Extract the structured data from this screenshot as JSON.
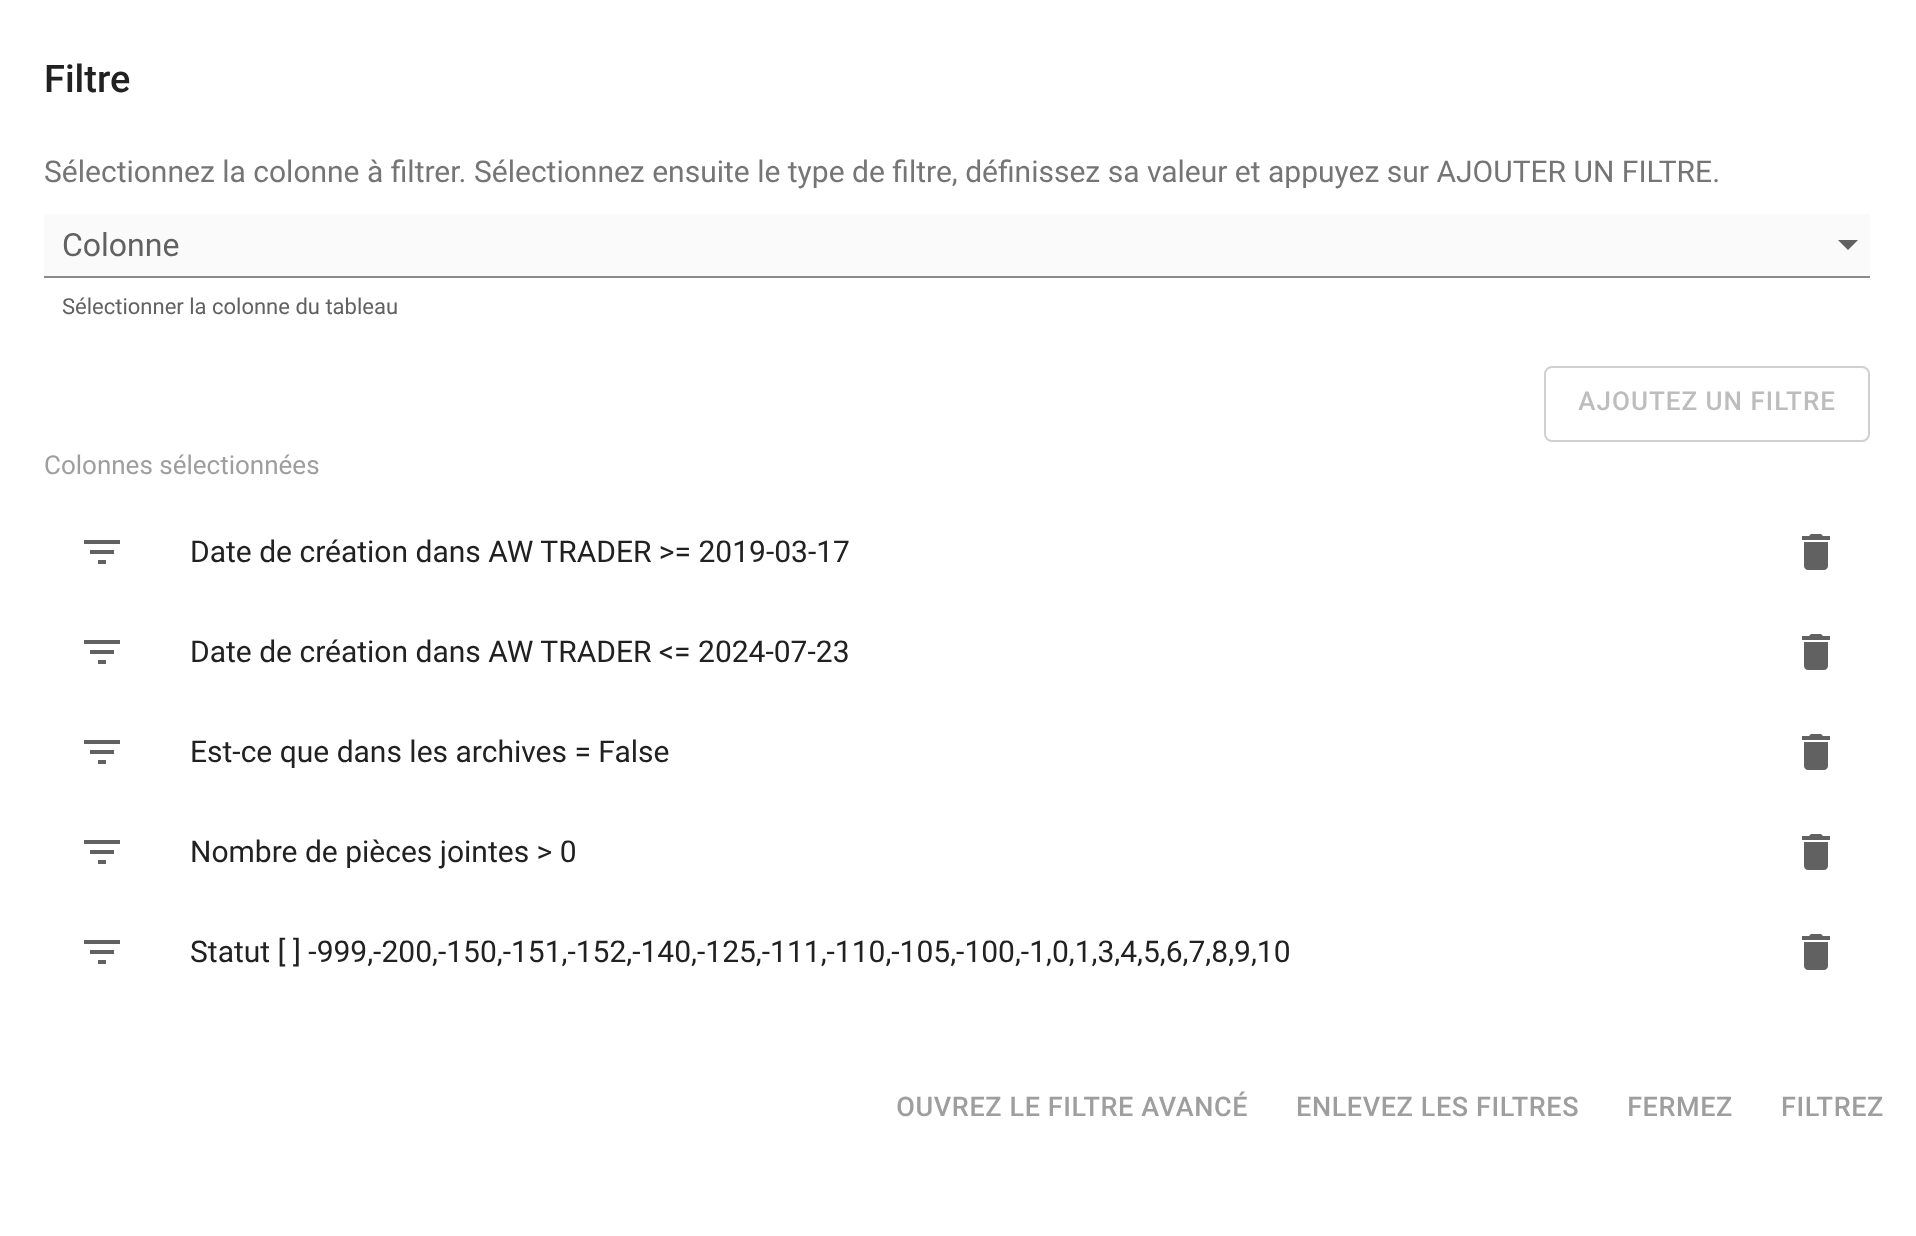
{
  "title": "Filtre",
  "description": "Sélectionnez la colonne à filtrer. Sélectionnez ensuite le type de filtre, définissez sa valeur et appuyez sur AJOUTER UN FILTRE.",
  "column_select": {
    "placeholder": "Colonne",
    "helper": "Sélectionner la colonne du tableau"
  },
  "add_button": {
    "label": "AJOUTEZ UN FILTRE",
    "disabled": true
  },
  "selected_heading": "Colonnes sélectionnées",
  "filters": [
    {
      "label": "Date de création dans AW TRADER >= 2019-03-17"
    },
    {
      "label": "Date de création dans AW TRADER <= 2024-07-23"
    },
    {
      "label": "Est-ce que dans les archives = False"
    },
    {
      "label": "Nombre de pièces jointes > 0"
    },
    {
      "label": "Statut [ ] -999,-200,-150,-151,-152,-140,-125,-111,-110,-105,-100,-1,0,1,3,4,5,6,7,8,9,10"
    }
  ],
  "actions": [
    "OUVREZ LE FILTRE AVANCÉ",
    "ENLEVEZ LES FILTRES",
    "FERMEZ",
    "FILTREZ"
  ]
}
